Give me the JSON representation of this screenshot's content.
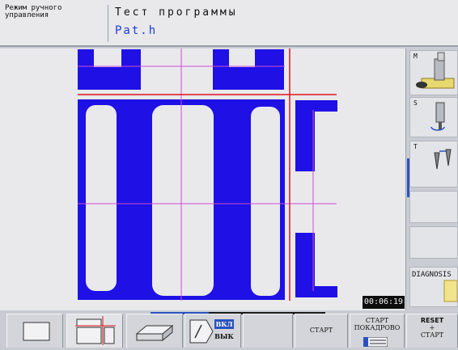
{
  "header": {
    "mode_line1": "Режим ручного",
    "mode_line2": "управления",
    "title_line1": "Тест программы",
    "title_line2": "Pat.h"
  },
  "status": {
    "timer": "00:06:19"
  },
  "right_panel": {
    "cells": [
      {
        "letter": "M",
        "icon": "spindle-m-icon"
      },
      {
        "letter": "S",
        "icon": "spindle-s-icon"
      },
      {
        "letter": "T",
        "icon": "tool-t-icon"
      }
    ],
    "diagnosis": "DIAGNOSIS"
  },
  "softkeys": {
    "on_label": "ВКЛ",
    "off_label": "ВЫК",
    "start": "СТАРТ",
    "start_block_line1": "СТАРТ",
    "start_block_line2": "ПОКАДРОВО",
    "reset_line1": "RESET",
    "reset_line2": "+",
    "reset_line3": "СТАРТ"
  },
  "colors": {
    "material": "#1f10e6",
    "crosshair_red": "#e0141e",
    "grid_magenta": "#d14bd6"
  }
}
